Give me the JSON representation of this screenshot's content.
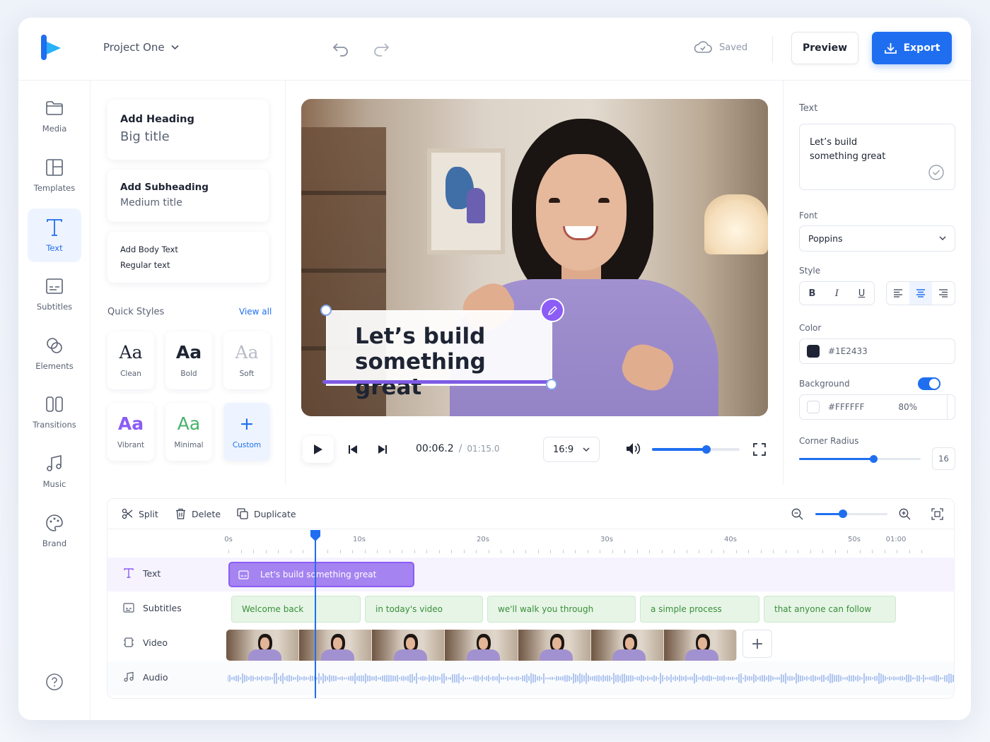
{
  "topbar": {
    "project_name": "Project One",
    "saved_label": "Saved",
    "preview_label": "Preview",
    "export_label": "Export"
  },
  "nav": {
    "items": [
      {
        "label": "Media",
        "icon": "folder-icon"
      },
      {
        "label": "Templates",
        "icon": "templates-icon"
      },
      {
        "label": "Text",
        "icon": "text-icon",
        "active": true
      },
      {
        "label": "Subtitles",
        "icon": "subtitles-icon"
      },
      {
        "label": "Elements",
        "icon": "elements-icon"
      },
      {
        "label": "Transitions",
        "icon": "transitions-icon"
      },
      {
        "label": "Music",
        "icon": "music-icon"
      },
      {
        "label": "Brand",
        "icon": "palette-icon"
      }
    ]
  },
  "text_panel": {
    "heading": {
      "title": "Add Heading",
      "sub": "Big title"
    },
    "subheading": {
      "title": "Add Subheading",
      "sub": "Medium title"
    },
    "body": {
      "title": "Add Body Text",
      "sub": "Regular text"
    },
    "quick_styles_label": "Quick Styles",
    "view_all_label": "View all",
    "styles": [
      {
        "glyph": "Aa",
        "label": "Clean"
      },
      {
        "glyph": "Aa",
        "label": "Bold"
      },
      {
        "glyph": "Aa",
        "label": "Soft"
      },
      {
        "glyph": "Aa",
        "label": "Vibrant"
      },
      {
        "glyph": "Aa",
        "label": "Minimal"
      },
      {
        "glyph": "+",
        "label": "Custom"
      }
    ]
  },
  "preview": {
    "caption_line1": "Let’s build",
    "caption_line2": "something great",
    "current_time": "00:06.2",
    "separator": "/",
    "total_time": "01:15.0",
    "aspect_ratio": "16:9",
    "volume": 0.62
  },
  "properties": {
    "text_label": "Text",
    "text_value_line1": "Let’s build",
    "text_value_line2": "something great",
    "font_label": "Font",
    "font_value": "Poppins",
    "style_label": "Style",
    "style_buttons": [
      "B",
      "I",
      "U"
    ],
    "color_label": "Color",
    "color_value": "#1E2433",
    "background_label": "Background",
    "background_enabled": true,
    "background_value": "#FFFFFF",
    "background_opacity": "80%",
    "corner_radius_label": "Corner Radius",
    "corner_radius_value": "16",
    "corner_radius_level": 0.61
  },
  "timeline": {
    "tools": {
      "split": "Split",
      "delete": "Delete",
      "duplicate": "Duplicate"
    },
    "zoom_level": 0.38,
    "ruler": [
      "0s",
      "10s",
      "20s",
      "30s",
      "40s",
      "50s",
      "01:00"
    ],
    "tracks": {
      "text": "Text",
      "subtitles": "Subtitles",
      "video": "Video",
      "audio": "Audio"
    },
    "text_clip": "Let's build something great",
    "subtitle_clips": [
      "Welcome back",
      "in today's video",
      "we'll walk you through",
      "a simple process",
      "that anyone can follow"
    ],
    "add_label": "+"
  },
  "colors": {
    "accent": "#1F6EF0",
    "caption_purple": "#8B5CF6",
    "subtitle_green": "#3A8E3A"
  }
}
